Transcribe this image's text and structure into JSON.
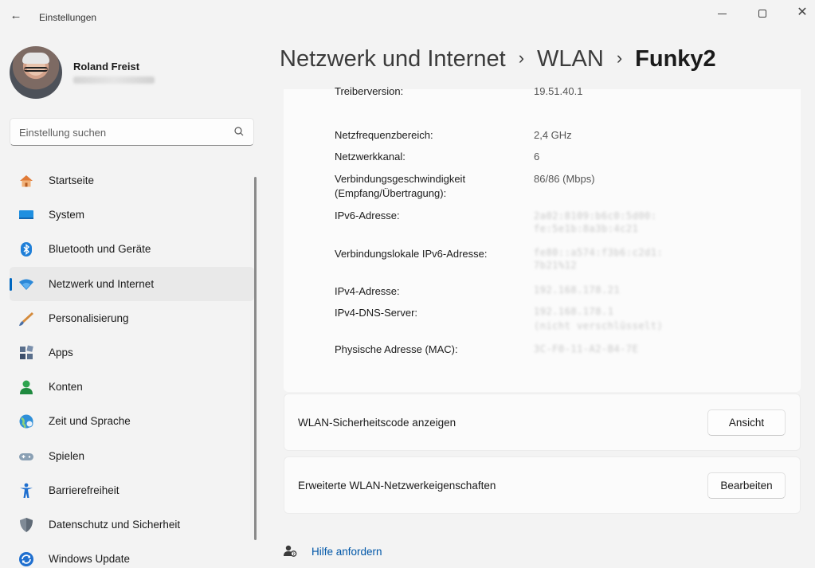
{
  "titlebar": {
    "back_icon": "arrow-left-icon",
    "title": "Einstellungen",
    "minimize_icon": "minimize-icon",
    "maximize_icon": "maximize-icon",
    "close_icon": "close-icon"
  },
  "user": {
    "name": "Roland Freist"
  },
  "search": {
    "placeholder": "Einstellung suchen",
    "icon": "search-icon"
  },
  "sidebar": {
    "items": [
      {
        "label": "Startseite",
        "icon": "home-icon"
      },
      {
        "label": "System",
        "icon": "system-display-icon"
      },
      {
        "label": "Bluetooth und Geräte",
        "icon": "bluetooth-icon"
      },
      {
        "label": "Netzwerk und Internet",
        "icon": "wifi-icon",
        "active": true
      },
      {
        "label": "Personalisierung",
        "icon": "brush-icon"
      },
      {
        "label": "Apps",
        "icon": "apps-icon"
      },
      {
        "label": "Konten",
        "icon": "account-icon"
      },
      {
        "label": "Zeit und Sprache",
        "icon": "globe-clock-icon"
      },
      {
        "label": "Spielen",
        "icon": "gamepad-icon"
      },
      {
        "label": "Barrierefreiheit",
        "icon": "accessibility-icon"
      },
      {
        "label": "Datenschutz und Sicherheit",
        "icon": "shield-icon"
      },
      {
        "label": "Windows Update",
        "icon": "update-icon"
      }
    ]
  },
  "breadcrumb": {
    "items": [
      "Netzwerk und Internet",
      "WLAN",
      "Funky2"
    ],
    "separator": "›"
  },
  "properties": {
    "rows": [
      {
        "label": "Treiberversion:",
        "value": "19.51.40.1"
      },
      {
        "label": "Netzfrequenzbereich:",
        "value": "2,4 GHz"
      },
      {
        "label": "Netzwerkkanal:",
        "value": "6"
      },
      {
        "label": "Verbindungsgeschwindigkeit",
        "label2": "(Empfang/Übertragung):",
        "value": "86/86 (Mbps)"
      },
      {
        "label": "IPv6-Adresse:",
        "value": "2a02:8109:b6c0:5d00:",
        "value2": "fe:5e1b:8a3b:4c21"
      },
      {
        "label": "Verbindungslokale IPv6-Adresse:",
        "value": "fe80::a574:f3b6:c2d1:",
        "value2": "7b21%12"
      },
      {
        "label": "IPv4-Adresse:",
        "value": "192.168.178.21"
      },
      {
        "label": "IPv4-DNS-Server:",
        "value": "192.168.178.1",
        "value2": "(nicht verschlüsselt)"
      },
      {
        "label": "Physische Adresse (MAC):",
        "value": "3C-F0-11-A2-B4-7E"
      }
    ]
  },
  "actions": [
    {
      "label": "WLAN-Sicherheitscode anzeigen",
      "button": "Ansicht"
    },
    {
      "label": "Erweiterte WLAN-Netzwerkeigenschaften",
      "button": "Bearbeiten"
    }
  ],
  "help": {
    "label": "Hilfe anfordern",
    "icon": "help-person-icon"
  },
  "colors": {
    "accent": "#0067c0",
    "link": "#0057a8",
    "window_bg": "#f3f3f3",
    "card_bg": "#fbfbfb"
  }
}
